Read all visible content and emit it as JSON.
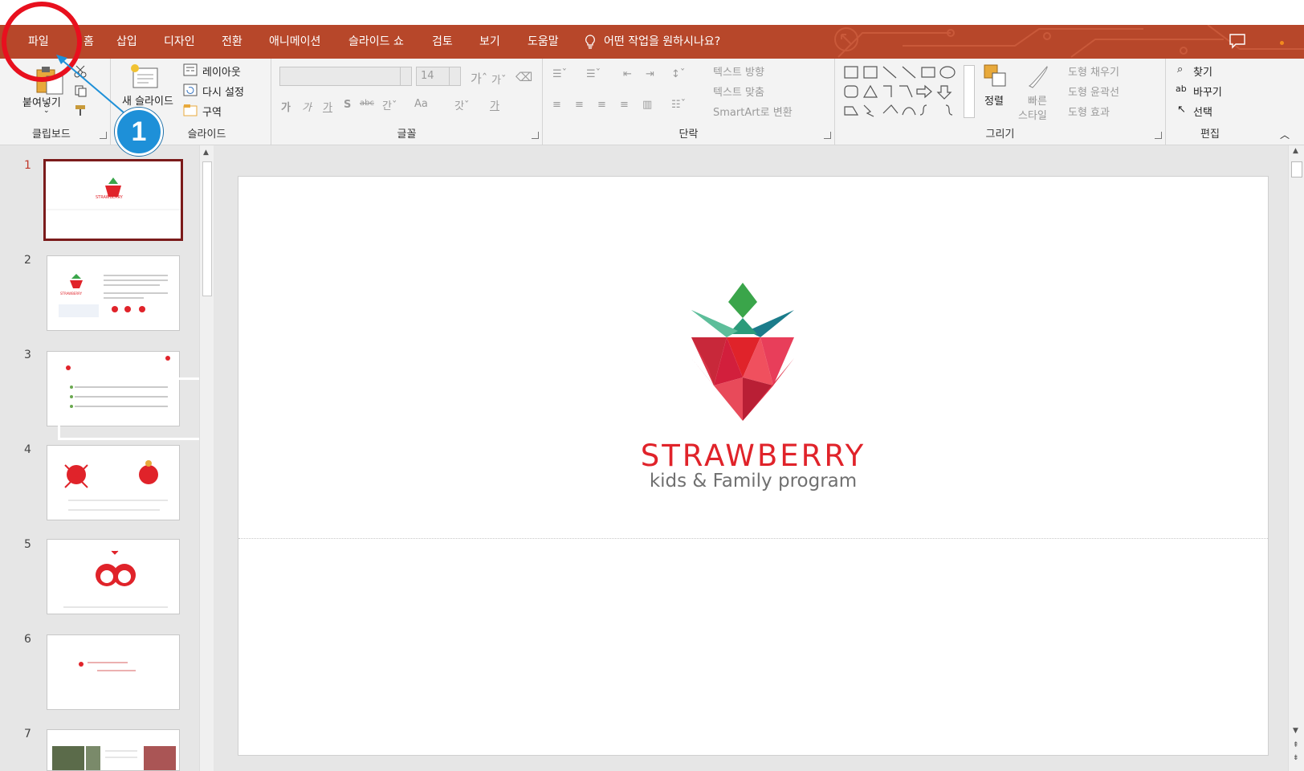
{
  "tabs": [
    {
      "label": "파일"
    },
    {
      "label": "홈"
    },
    {
      "label": "삽입"
    },
    {
      "label": "디자인"
    },
    {
      "label": "전환"
    },
    {
      "label": "애니메이션"
    },
    {
      "label": "슬라이드 쇼"
    },
    {
      "label": "검토"
    },
    {
      "label": "보기"
    },
    {
      "label": "도움말"
    }
  ],
  "tellme": "어떤 작업을 원하시나요?",
  "ribbon": {
    "clipboard": {
      "paste": "붙여넣기",
      "group": "클립보드"
    },
    "slides": {
      "new_slide": "새 슬라이드",
      "layout": "레이아웃",
      "reset": "다시 설정",
      "section": "구역",
      "group": "슬라이드"
    },
    "font": {
      "size": "14",
      "group": "글꼴",
      "change_case": "Aa",
      "korean": "가"
    },
    "paragraph": {
      "text_direction": "텍스트 방향",
      "align_text": "텍스트 맞춤",
      "smartart": "SmartArt로 변환",
      "group": "단락"
    },
    "drawing": {
      "arrange": "정렬",
      "quick_styles_1": "빠른",
      "quick_styles_2": "스타일",
      "fill": "도형 채우기",
      "outline": "도형 윤곽선",
      "effects": "도형 효과",
      "group": "그리기"
    },
    "editing": {
      "find": "찾기",
      "replace": "바꾸기",
      "select": "선택",
      "group": "편집"
    }
  },
  "thumbnails": [
    {
      "num": "1"
    },
    {
      "num": "2"
    },
    {
      "num": "3"
    },
    {
      "num": "4"
    },
    {
      "num": "5"
    },
    {
      "num": "6"
    },
    {
      "num": "7"
    }
  ],
  "slide": {
    "title": "STRAWBERRY",
    "subtitle": "kids & Family program"
  },
  "thumb_titles": {
    "t1": "STRAWBERRY",
    "t2": "STRAWBERRY"
  },
  "annotation": {
    "badge": "1"
  },
  "colors": {
    "accent": "#b7472a",
    "strawberry_red": "#e0232a",
    "annotation_red": "#e8101e",
    "annotation_blue": "#1e90d8"
  }
}
